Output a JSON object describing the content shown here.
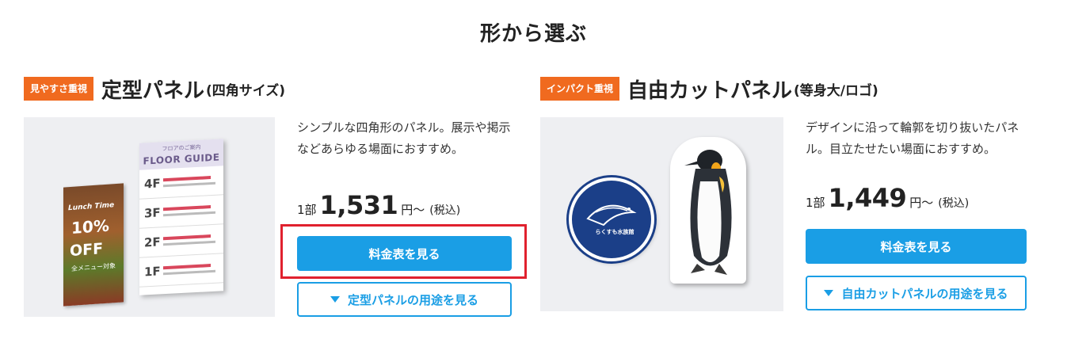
{
  "section_title": "形から選ぶ",
  "cards": [
    {
      "badge": "見やすさ重視",
      "name": "定型パネル",
      "name_sub": "(四角サイズ)",
      "description": "シンプルな四角形のパネル。展示や掲示などあらゆる場面におすすめ。",
      "price_unit": "1部",
      "price": "1,531",
      "price_yen": "円〜",
      "price_tax": "(税込)",
      "primary_button": "料金表を見る",
      "secondary_button": "定型パネルの用途を見る",
      "image": {
        "poster_line1": "Lunch Time",
        "poster_line2": "10%",
        "poster_line3": "OFF",
        "poster_line4": "全メニュー対象",
        "guide_small": "フロアのご案内",
        "guide_title": "FLOOR GUIDE",
        "floors": [
          "4F",
          "3F",
          "2F",
          "1F"
        ]
      }
    },
    {
      "badge": "インパクト重視",
      "name": "自由カットパネル",
      "name_sub": "(等身大/ロゴ)",
      "description": "デザインに沿って輪郭を切り抜いたパネル。目立たせたい場面におすすめ。",
      "price_unit": "1部",
      "price": "1,449",
      "price_yen": "円〜",
      "price_tax": "(税込)",
      "primary_button": "料金表を見る",
      "secondary_button": "自由カットパネルの用途を見る",
      "image": {
        "logo_text": "らくすも水族館"
      }
    }
  ],
  "colors": {
    "badge": "#f06a1f",
    "primary": "#1a9ee5",
    "highlight": "#e0212e"
  }
}
